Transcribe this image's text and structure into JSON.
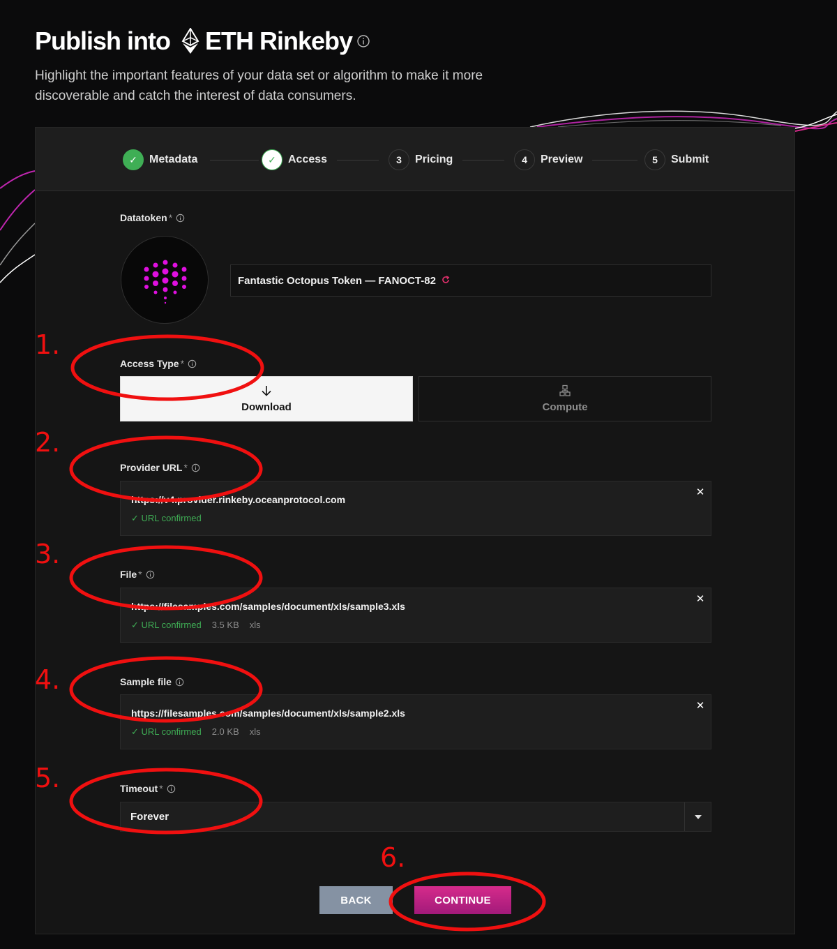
{
  "header": {
    "title_prefix": "Publish into",
    "network": "ETH Rinkeby",
    "subtitle": "Highlight the important features of your data set or algorithm to make it more discoverable and catch the interest of data consumers."
  },
  "steps": [
    {
      "number": "1",
      "label": "Metadata",
      "state": "done"
    },
    {
      "number": "2",
      "label": "Access",
      "state": "current"
    },
    {
      "number": "3",
      "label": "Pricing",
      "state": "pending"
    },
    {
      "number": "4",
      "label": "Preview",
      "state": "pending"
    },
    {
      "number": "5",
      "label": "Submit",
      "state": "pending"
    }
  ],
  "step_check": "✓",
  "required_mark": "*",
  "datatoken": {
    "label": "Datatoken",
    "name": "Fantastic Octopus Token — FANOCT-82",
    "refresh_icon": "refresh-icon"
  },
  "access_type": {
    "label": "Access Type",
    "options": [
      {
        "label": "Download",
        "icon": "arrow-down-icon",
        "selected": true
      },
      {
        "label": "Compute",
        "icon": "hierarchy-icon",
        "selected": false
      }
    ]
  },
  "provider_url": {
    "label": "Provider URL",
    "value": "https://v4.provider.rinkeby.oceanprotocol.com",
    "status": "✓ URL confirmed"
  },
  "file": {
    "label": "File",
    "value": "https://filesamples.com/samples/document/xls/sample3.xls",
    "status": "✓ URL confirmed",
    "size": "3.5 KB",
    "type": "xls"
  },
  "sample_file": {
    "label": "Sample file",
    "value": "https://filesamples.com/samples/document/xls/sample2.xls",
    "status": "✓ URL confirmed",
    "size": "2.0 KB",
    "type": "xls"
  },
  "timeout": {
    "label": "Timeout",
    "value": "Forever"
  },
  "close_glyph": "✕",
  "buttons": {
    "back": "BACK",
    "continue": "CONTINUE"
  },
  "annotations": [
    "1.",
    "2.",
    "3.",
    "4.",
    "5.",
    "6."
  ],
  "colors": {
    "accent_pink": "#d62b8b",
    "success_green": "#3fae55",
    "annotation_red": "#f01010"
  }
}
